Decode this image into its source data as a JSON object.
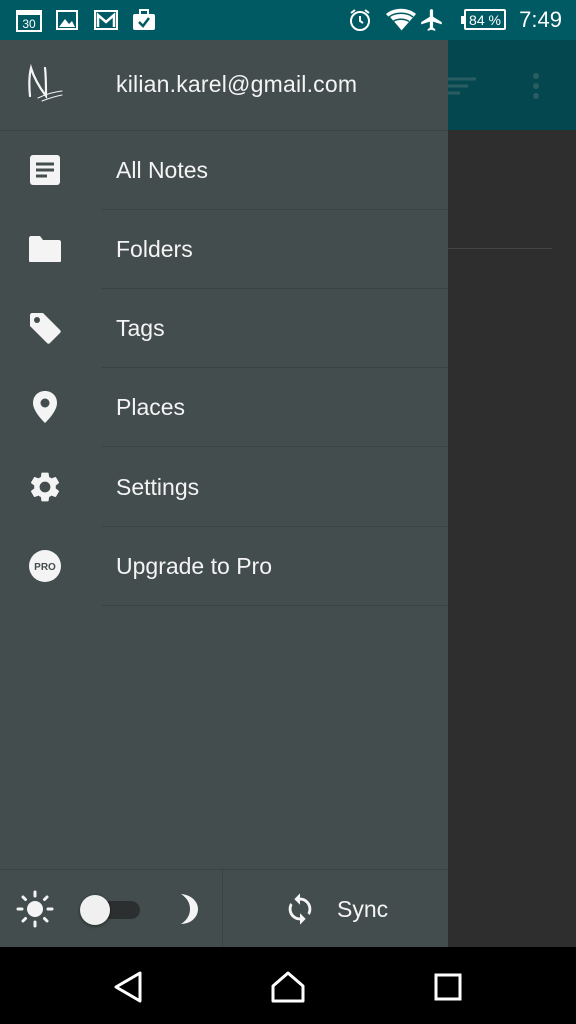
{
  "status_bar": {
    "calendar_day": "30",
    "battery_percent": "84 %",
    "time": "7:49",
    "icons": [
      "calendar-icon",
      "image-icon",
      "gmail-icon",
      "briefcase-check-icon",
      "alarm-icon",
      "wifi-icon",
      "airplane-icon",
      "battery-icon"
    ]
  },
  "drawer": {
    "account_email": "kilian.karel@gmail.com",
    "items": [
      {
        "label": "All Notes",
        "icon": "notes-icon"
      },
      {
        "label": "Folders",
        "icon": "folder-icon"
      },
      {
        "label": "Tags",
        "icon": "tag-icon"
      },
      {
        "label": "Places",
        "icon": "place-pin-icon"
      },
      {
        "label": "Settings",
        "icon": "gear-icon"
      },
      {
        "label": "Upgrade to Pro",
        "icon": "pro-badge-icon",
        "icon_text": "PRO"
      }
    ],
    "footer": {
      "theme_toggle_on": false,
      "sync_label": "Sync"
    }
  },
  "colors": {
    "status_bar": "#005a63",
    "drawer_bg": "#434d4d",
    "text": "#f4f4f4"
  }
}
